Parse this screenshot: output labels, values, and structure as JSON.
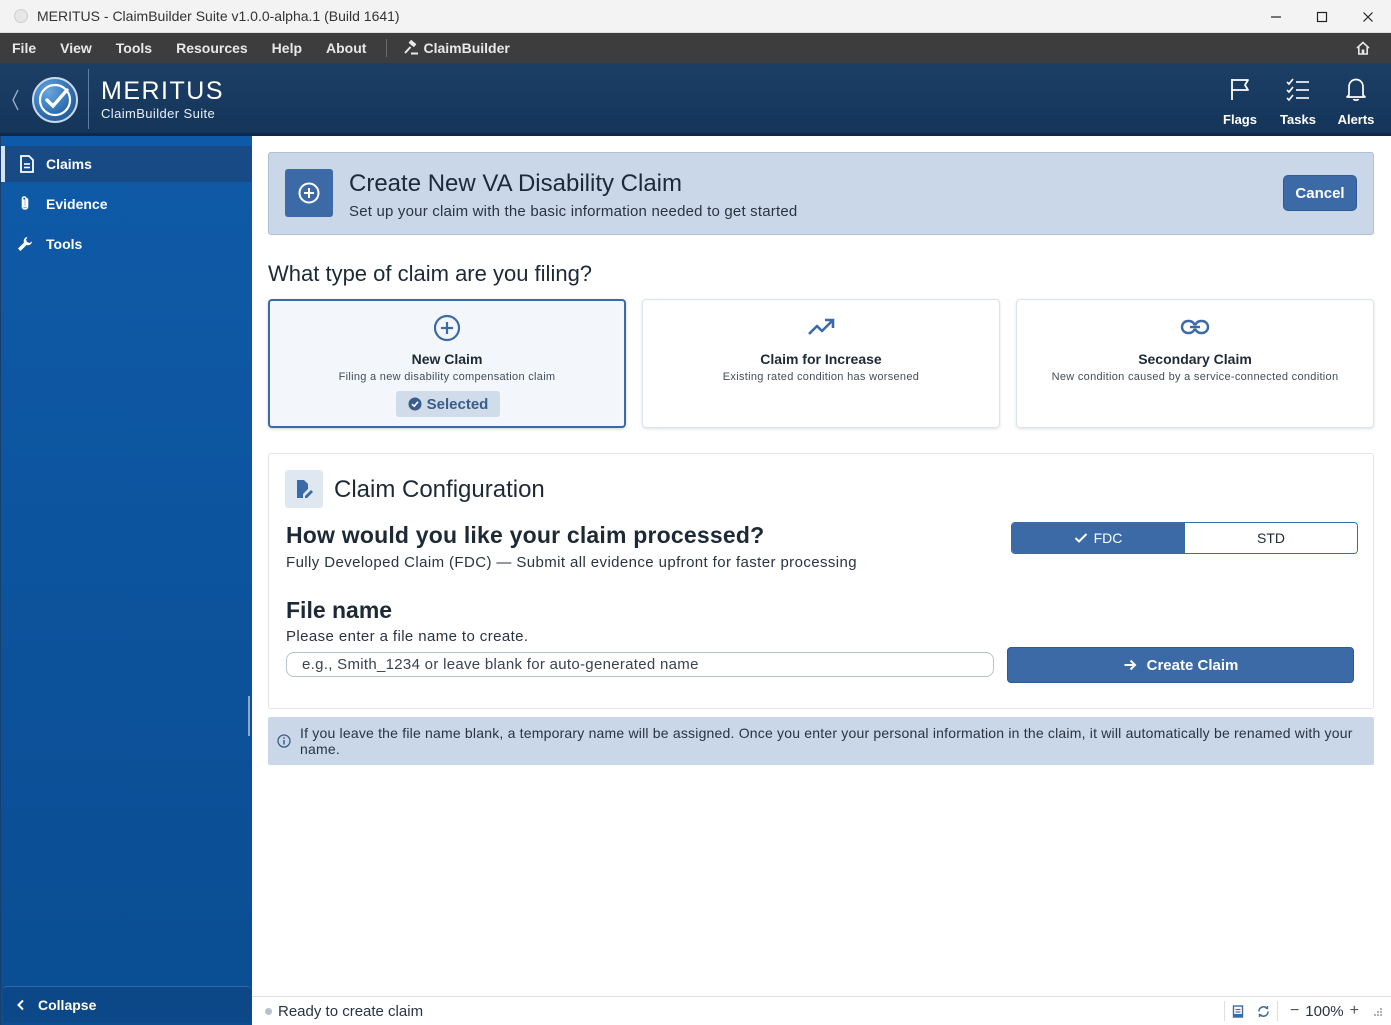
{
  "window": {
    "title": "MERITUS - ClaimBuilder Suite v1.0.0-alpha.1 (Build 1641)"
  },
  "menu": {
    "items": [
      "File",
      "View",
      "Tools",
      "Resources",
      "Help",
      "About"
    ],
    "brand": "ClaimBuilder"
  },
  "header": {
    "brand_name": "MERITUS",
    "brand_sub": "ClaimBuilder Suite",
    "actions": [
      {
        "label": "Flags",
        "icon": "flag-icon"
      },
      {
        "label": "Tasks",
        "icon": "tasks-icon"
      },
      {
        "label": "Alerts",
        "icon": "bell-icon"
      }
    ]
  },
  "sidebar": {
    "items": [
      {
        "label": "Claims",
        "icon": "document-icon",
        "active": true
      },
      {
        "label": "Evidence",
        "icon": "paperclip-icon",
        "active": false
      },
      {
        "label": "Tools",
        "icon": "wrench-icon",
        "active": false
      }
    ],
    "collapse_label": "Collapse"
  },
  "page": {
    "title": "Create New VA Disability Claim",
    "subtitle": "Set up your claim with the basic information needed to get started",
    "cancel_label": "Cancel",
    "question": "What type of claim are you filing?",
    "claim_types": [
      {
        "title": "New Claim",
        "desc": "Filing a new disability compensation claim",
        "icon": "plus-circle-icon",
        "selected": true,
        "badge": "Selected"
      },
      {
        "title": "Claim for Increase",
        "desc": "Existing rated condition has worsened",
        "icon": "trending-up-icon",
        "selected": false
      },
      {
        "title": "Secondary Claim",
        "desc": "New condition caused by a service-connected condition",
        "icon": "link-icon",
        "selected": false
      }
    ]
  },
  "config": {
    "title": "Claim Configuration",
    "process_question": "How would you like your claim processed?",
    "process_desc": "Fully Developed Claim (FDC) — Submit all evidence upfront for faster processing",
    "options": [
      {
        "label": "FDC",
        "selected": true
      },
      {
        "label": "STD",
        "selected": false
      }
    ],
    "file_name_title": "File name",
    "file_name_desc": "Please enter a file name to create.",
    "file_name_value": "",
    "file_name_placeholder": "e.g., Smith_1234 or leave blank for auto-generated name",
    "create_label": "Create Claim"
  },
  "info": {
    "text": "If you leave the file name blank, a temporary name will be assigned. Once you enter your personal information in the claim, it will automatically be renamed with your name."
  },
  "status": {
    "text": "Ready to create claim",
    "zoom": "100%",
    "zoom_out": "−",
    "zoom_in": "+"
  },
  "colors": {
    "accent": "#3b6aa6",
    "sidebar": "#0f5aa8",
    "header": "#1c3f66",
    "panel": "#c9d7e8"
  }
}
